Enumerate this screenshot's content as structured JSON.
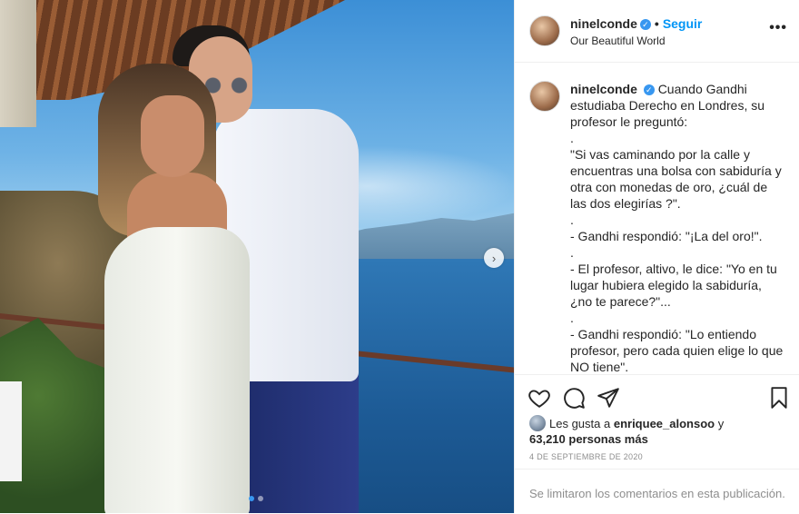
{
  "post": {
    "username": "ninelconde",
    "follow_label": "Seguir",
    "separator": "•",
    "location": "Our Beautiful World",
    "more_label": "•••",
    "verified_mark": "✓"
  },
  "caption": {
    "username": "ninelconde",
    "lines": [
      "Cuando Gandhi estudiaba Derecho en Londres, su profesor le preguntó:",
      ".",
      "\"Si vas caminando por la calle y encuentras una bolsa con sabiduría y otra con monedas de oro, ¿cuál de las dos elegirías ?\".",
      ".",
      "- Gandhi respondió: \"¡La del oro!\".",
      ".",
      "- El profesor, altivo, le dice: \"Yo en tu lugar hubiera elegido la sabiduría, ¿no te parece?\"...",
      ".",
      "- Gandhi respondió: \"Lo entiendo profesor, pero cada quien elige lo que NO tiene\".",
      "."
    ]
  },
  "likes": {
    "prefix": "Les gusta a",
    "user": "enriquee_alonsoo",
    "conjunction": "y",
    "count": "63,210 personas más"
  },
  "date": "4 DE SEPTIEMBRE DE 2020",
  "comments_limited": "Se limitaron los comentarios en esta publicación.",
  "icons": {
    "like": "heart-icon",
    "comment": "comment-icon",
    "share": "share-icon",
    "save": "bookmark-icon",
    "next": "chevron-right-icon"
  },
  "carousel": {
    "current": 1,
    "total": 2
  },
  "colors": {
    "accent": "#0095f6",
    "verified": "#3897f0",
    "text": "#262626",
    "muted": "#8e8e8e"
  }
}
